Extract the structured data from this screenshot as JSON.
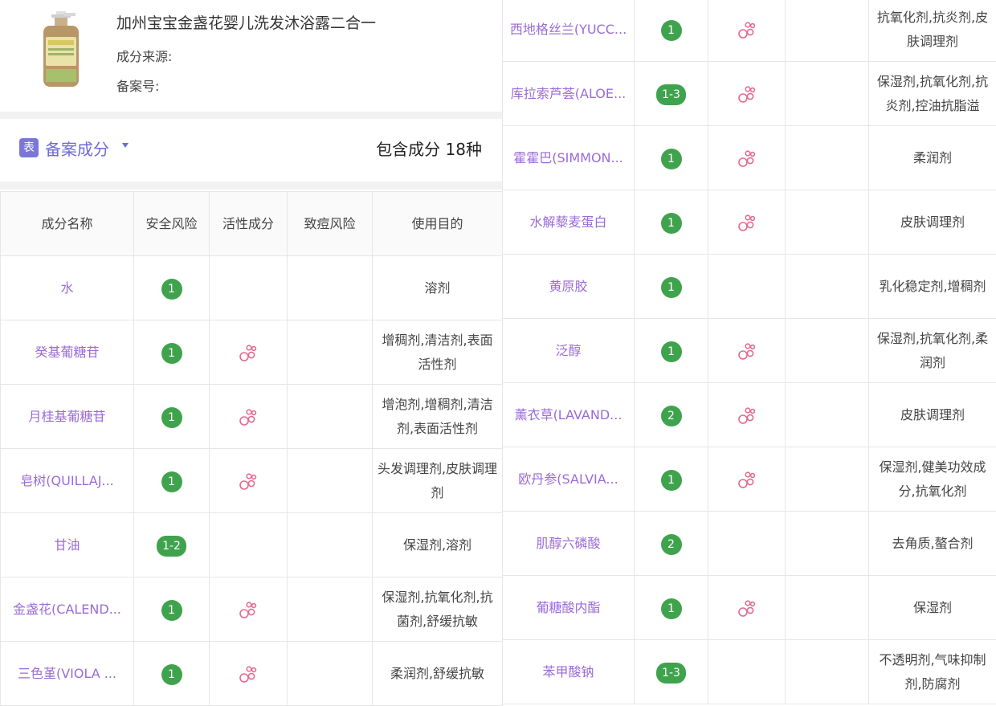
{
  "product": {
    "title": "加州宝宝金盏花婴儿洗发沐浴露二合一",
    "source_label": "成分来源:",
    "record_label": "备案号:"
  },
  "section": {
    "icon_text": "表",
    "label": "备案成分",
    "count_text": "包含成分 18种"
  },
  "table": {
    "headers": [
      "成分名称",
      "安全风险",
      "活性成分",
      "致痘风险",
      "使用目的"
    ]
  },
  "left_rows": [
    {
      "name": "水",
      "risk": "1",
      "active": false,
      "purpose": "溶剂"
    },
    {
      "name": "癸基葡糖苷",
      "risk": "1",
      "active": true,
      "purpose": "增稠剂,清洁剂,表面活性剂"
    },
    {
      "name": "月桂基葡糖苷",
      "risk": "1",
      "active": true,
      "purpose": "增泡剂,增稠剂,清洁剂,表面活性剂"
    },
    {
      "name": "皂树(QUILLAJ...",
      "risk": "1",
      "active": true,
      "purpose": "头发调理剂,皮肤调理剂"
    },
    {
      "name": "甘油",
      "risk": "1-2",
      "active": false,
      "purpose": "保湿剂,溶剂"
    },
    {
      "name": "金盏花(CALEND...",
      "risk": "1",
      "active": true,
      "purpose": "保湿剂,抗氧化剂,抗菌剂,舒缓抗敏"
    },
    {
      "name": "三色堇(VIOLA ...",
      "risk": "1",
      "active": true,
      "purpose": "柔润剂,舒缓抗敏"
    }
  ],
  "right_rows": [
    {
      "name": "西地格丝兰(YUCC...",
      "risk": "1",
      "active": true,
      "purpose": "抗氧化剂,抗炎剂,皮肤调理剂"
    },
    {
      "name": "库拉索芦荟(ALOE...",
      "risk": "1-3",
      "active": true,
      "purpose": "保湿剂,抗氧化剂,抗炎剂,控油抗脂溢"
    },
    {
      "name": "霍霍巴(SIMMON...",
      "risk": "1",
      "active": true,
      "purpose": "柔润剂"
    },
    {
      "name": "水解藜麦蛋白",
      "risk": "1",
      "active": true,
      "purpose": "皮肤调理剂"
    },
    {
      "name": "黄原胶",
      "risk": "1",
      "active": false,
      "purpose": "乳化稳定剂,增稠剂"
    },
    {
      "name": "泛醇",
      "risk": "1",
      "active": true,
      "purpose": "保湿剂,抗氧化剂,柔润剂"
    },
    {
      "name": "薰衣草(LAVAND...",
      "risk": "2",
      "active": true,
      "purpose": "皮肤调理剂"
    },
    {
      "name": "欧丹参(SALVIA...",
      "risk": "1",
      "active": true,
      "purpose": "保湿剂,健美功效成分,抗氧化剂"
    },
    {
      "name": "肌醇六磷酸",
      "risk": "2",
      "active": false,
      "purpose": "去角质,螯合剂"
    },
    {
      "name": "葡糖酸内酯",
      "risk": "1",
      "active": true,
      "purpose": "保湿剂"
    },
    {
      "name": "苯甲酸钠",
      "risk": "1-3",
      "active": false,
      "purpose": "不透明剂,气味抑制剂,防腐剂"
    }
  ],
  "colors": {
    "name": "#9b6bd6",
    "badge": "#3fa34d",
    "active_icon": "#e46a8f",
    "accent": "#6e6ad6"
  },
  "icons": {
    "active": "bubbles-icon",
    "section": "table-icon",
    "dropdown": "caret-down-icon"
  }
}
